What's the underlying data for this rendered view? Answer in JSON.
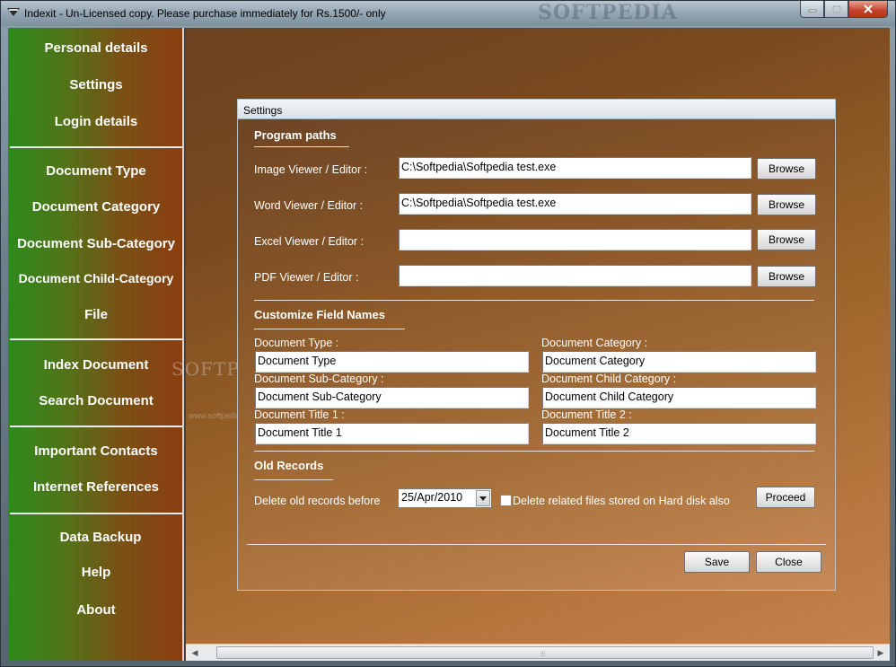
{
  "window": {
    "title": "Indexit - Un-Licensed copy. Please purchase immediately for Rs.1500/- only",
    "watermark": "SOFTPEDIA"
  },
  "sidebar": {
    "groups": [
      [
        "Personal details",
        "Settings",
        "Login details"
      ],
      [
        "Document Type",
        "Document Category",
        "Document Sub-Category",
        "Document Child-Category",
        "File"
      ],
      [
        "Index Document",
        "Search Document"
      ],
      [
        "Important Contacts",
        "Internet References"
      ],
      [
        "Data Backup",
        "Help",
        "About"
      ]
    ]
  },
  "background_watermark": {
    "text": "SOFTPEDIA",
    "url": "www.softpedia.com"
  },
  "dialog": {
    "title": "Settings",
    "program_paths": {
      "heading": "Program paths",
      "rows": [
        {
          "label": "Image Viewer / Editor :",
          "value": "C:\\Softpedia\\Softpedia test.exe",
          "button": "Browse"
        },
        {
          "label": "Word Viewer / Editor :",
          "value": "C:\\Softpedia\\Softpedia test.exe",
          "button": "Browse"
        },
        {
          "label": "Excel Viewer / Editor :",
          "value": "",
          "button": "Browse"
        },
        {
          "label": "PDF Viewer / Editor :",
          "value": "",
          "button": "Browse"
        }
      ]
    },
    "field_names": {
      "heading": "Customize Field Names",
      "fields": [
        {
          "label": "Document Type :",
          "value": "Document Type"
        },
        {
          "label": "Document Category :",
          "value": "Document Category"
        },
        {
          "label": "Document Sub-Category :",
          "value": "Document Sub-Category"
        },
        {
          "label": "Document Child Category :",
          "value": "Document Child Category"
        },
        {
          "label": "Document Title 1 :",
          "value": "Document Title 1"
        },
        {
          "label": "Document Title 2 :",
          "value": "Document Title 2"
        }
      ]
    },
    "old_records": {
      "heading": "Old Records",
      "delete_label": "Delete old records before",
      "date_value": "25/Apr/2010",
      "checkbox_label": "Delete related files stored on Hard disk also",
      "checkbox_checked": false,
      "proceed_label": "Proceed"
    },
    "save_label": "Save",
    "close_label": "Close"
  }
}
